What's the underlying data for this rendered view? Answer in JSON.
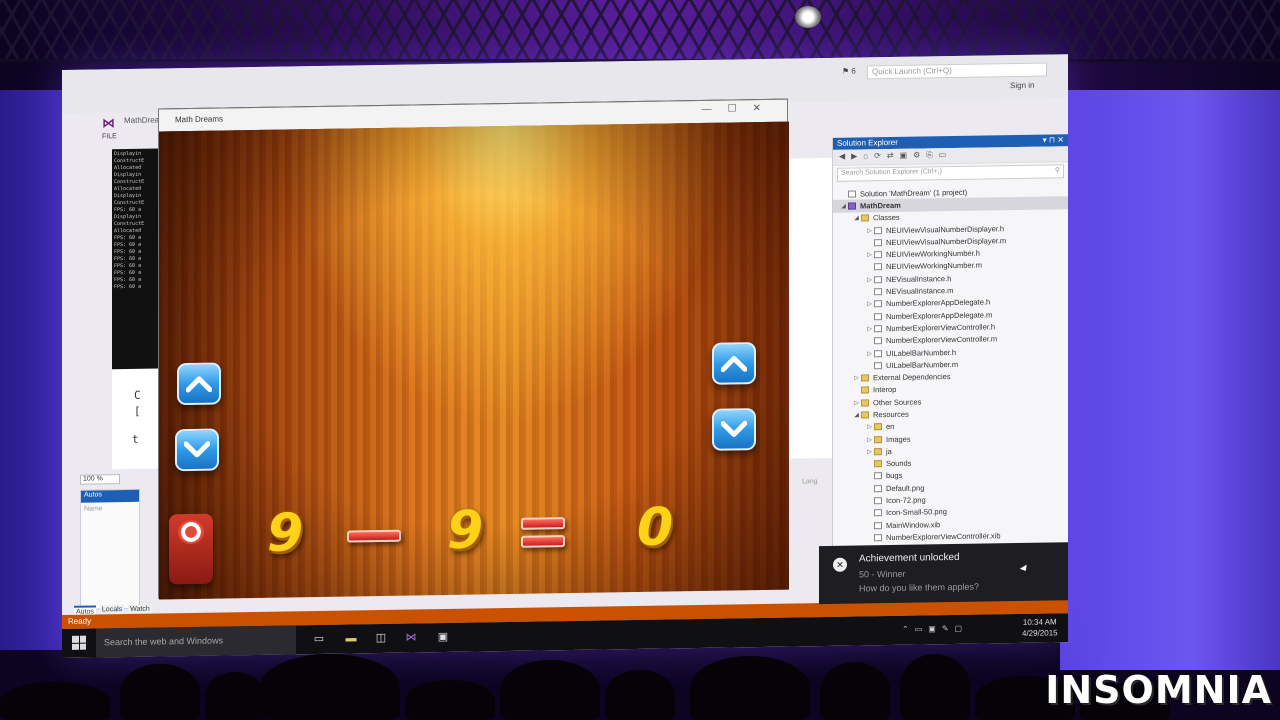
{
  "visual_studio": {
    "window_title": "MathDream (Running) - Microsoft Visual Studio",
    "quick_launch_placeholder": "Quick Launch (Ctrl+Q)",
    "notification_count": "6",
    "sign_in": "Sign in",
    "menu_file": "FILE",
    "zoom": "100 %",
    "status": "Ready",
    "autos_title": "Autos",
    "autos_column": "Name",
    "lang_column": "Lang",
    "bottom_tabs": [
      "Autos",
      "Locals",
      "Watch"
    ]
  },
  "solution_explorer": {
    "title": "Solution Explorer",
    "search_placeholder": "Search Solution Explorer (Ctrl+;)",
    "items": [
      {
        "label": "Solution 'MathDream' (1 project)",
        "depth": 0,
        "kind": "file",
        "expand": ""
      },
      {
        "label": "MathDream",
        "depth": 0,
        "kind": "proj",
        "expand": "down",
        "selected": true
      },
      {
        "label": "Classes",
        "depth": 1,
        "kind": "folder",
        "expand": "down"
      },
      {
        "label": "NEUIViewVisualNumberDisplayer.h",
        "depth": 2,
        "kind": "file",
        "expand": "right"
      },
      {
        "label": "NEUIViewVisualNumberDisplayer.m",
        "depth": 2,
        "kind": "file",
        "expand": ""
      },
      {
        "label": "NEUIViewWorkingNumber.h",
        "depth": 2,
        "kind": "file",
        "expand": "right"
      },
      {
        "label": "NEUIViewWorkingNumber.m",
        "depth": 2,
        "kind": "file",
        "expand": ""
      },
      {
        "label": "NEVisualInstance.h",
        "depth": 2,
        "kind": "file",
        "expand": "right"
      },
      {
        "label": "NEVisualInstance.m",
        "depth": 2,
        "kind": "file",
        "expand": ""
      },
      {
        "label": "NumberExplorerAppDelegate.h",
        "depth": 2,
        "kind": "file",
        "expand": "right"
      },
      {
        "label": "NumberExplorerAppDelegate.m",
        "depth": 2,
        "kind": "file",
        "expand": ""
      },
      {
        "label": "NumberExplorerViewController.h",
        "depth": 2,
        "kind": "file",
        "expand": "right"
      },
      {
        "label": "NumberExplorerViewController.m",
        "depth": 2,
        "kind": "file",
        "expand": ""
      },
      {
        "label": "UILabelBarNumber.h",
        "depth": 2,
        "kind": "file",
        "expand": "right"
      },
      {
        "label": "UILabelBarNumber.m",
        "depth": 2,
        "kind": "file",
        "expand": ""
      },
      {
        "label": "External Dependencies",
        "depth": 1,
        "kind": "folder",
        "expand": "right"
      },
      {
        "label": "Interop",
        "depth": 1,
        "kind": "folder",
        "expand": ""
      },
      {
        "label": "Other Sources",
        "depth": 1,
        "kind": "folder",
        "expand": "right"
      },
      {
        "label": "Resources",
        "depth": 1,
        "kind": "folder",
        "expand": "down"
      },
      {
        "label": "en",
        "depth": 2,
        "kind": "folder",
        "expand": "right"
      },
      {
        "label": "Images",
        "depth": 2,
        "kind": "folder",
        "expand": "right"
      },
      {
        "label": "ja",
        "depth": 2,
        "kind": "folder",
        "expand": "right"
      },
      {
        "label": "Sounds",
        "depth": 2,
        "kind": "folder",
        "expand": ""
      },
      {
        "label": "bugs",
        "depth": 2,
        "kind": "file",
        "expand": ""
      },
      {
        "label": "Default.png",
        "depth": 2,
        "kind": "file",
        "expand": ""
      },
      {
        "label": "Icon-72.png",
        "depth": 2,
        "kind": "file",
        "expand": ""
      },
      {
        "label": "Icon-Small-50.png",
        "depth": 2,
        "kind": "file",
        "expand": ""
      },
      {
        "label": "MainWindow.xib",
        "depth": 2,
        "kind": "file",
        "expand": ""
      },
      {
        "label": "NumberExplorerViewController.xib",
        "depth": 2,
        "kind": "file",
        "expand": ""
      }
    ]
  },
  "game": {
    "window_title": "Math Dreams",
    "left_operand": "9",
    "right_operand": "9",
    "result": "0"
  },
  "toast": {
    "title": "Achievement unlocked",
    "subtitle": "50 - Winner",
    "message": "How do you like them apples?"
  },
  "taskbar": {
    "search_placeholder": "Search the web and Windows",
    "time": "10:34 AM",
    "date": "4/29/2015"
  },
  "watermark": "INSOMNIA",
  "colors": {
    "vs_accent": "#1e5fb4",
    "status_bar": "#ca5100",
    "digit_yellow": "#ffd21a",
    "operator_red": "#c81e1e",
    "arrow_blue": "#2f9ae6"
  }
}
